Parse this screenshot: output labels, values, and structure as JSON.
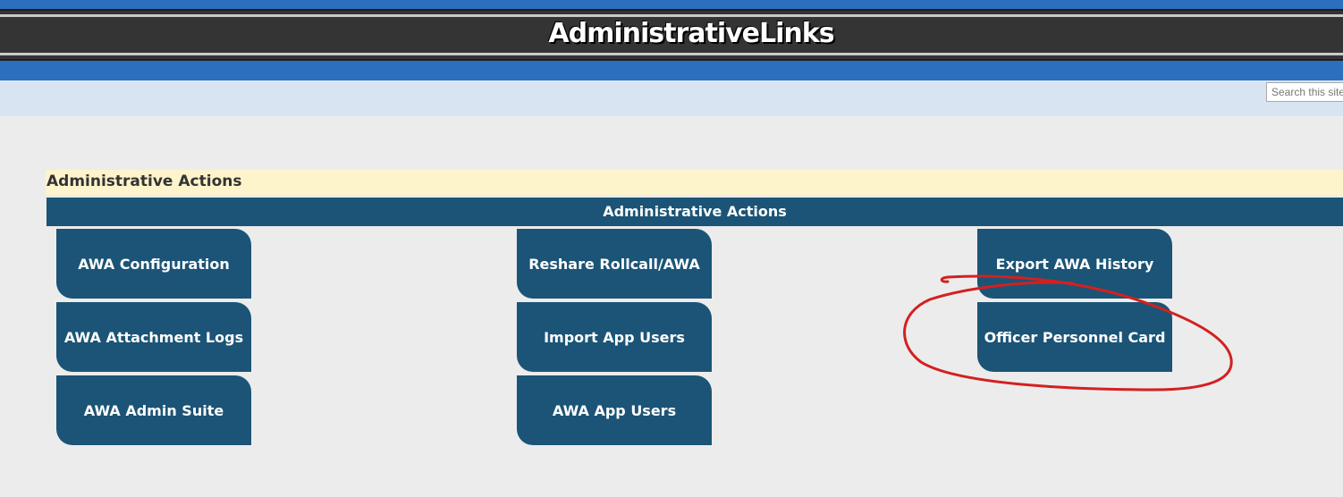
{
  "site": {
    "title": "AdministrativeLinks"
  },
  "search": {
    "placeholder": "Search this site"
  },
  "section": {
    "title": "Administrative Actions"
  },
  "table": {
    "header": "Administrative Actions"
  },
  "tiles": [
    {
      "label": "AWA Configuration"
    },
    {
      "label": "AWA Attachment Logs"
    },
    {
      "label": "AWA Admin Suite"
    },
    {
      "label": "Reshare Rollcall/AWA"
    },
    {
      "label": "Import App Users"
    },
    {
      "label": "AWA App Users"
    },
    {
      "label": "Export AWA History"
    },
    {
      "label": "Officer Personnel Card"
    }
  ],
  "colors": {
    "top_blue": "#2c6fbf",
    "banner_dark": "#343434",
    "search_band": "#d9e4f3",
    "page_bg": "#ececec",
    "section_bg": "#fdf4cc",
    "tile_bg": "#1b5476",
    "annotation_red": "#d42020"
  }
}
